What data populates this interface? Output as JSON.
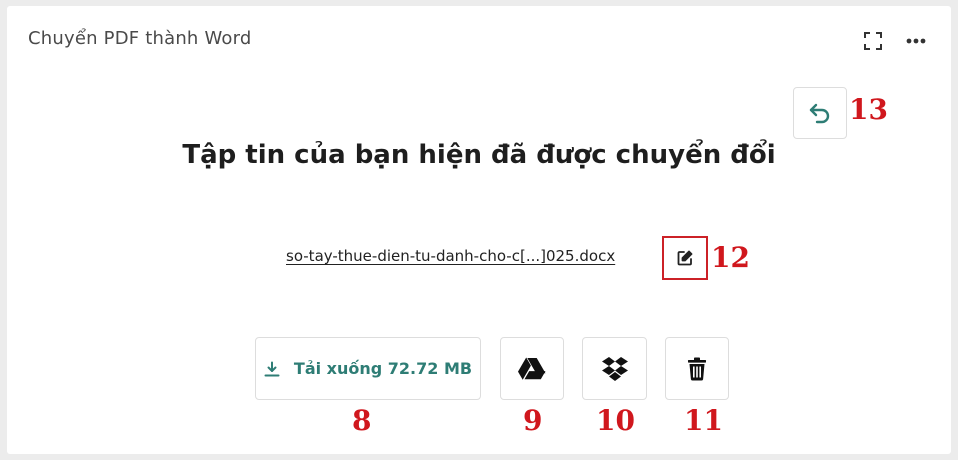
{
  "card": {
    "title": "Chuyển PDF thành Word"
  },
  "header_actions": {
    "expand_icon": "expand-icon",
    "more_icon": "more-horizontal-icon"
  },
  "result": {
    "heading": "Tập tin của bạn hiện đã được chuyển đổi",
    "filename": "so-tay-thue-dien-tu-danh-cho-c[...]025.docx"
  },
  "actions": {
    "download_label": "Tải xuống 72.72 MB",
    "download_icon": "download-icon",
    "gdrive_icon": "google-drive-icon",
    "dropbox_icon": "dropbox-icon",
    "delete_icon": "trash-icon",
    "rename_icon": "edit-icon",
    "undo_icon": "undo-icon"
  },
  "annotations": {
    "m8": "8",
    "m9": "9",
    "m10": "10",
    "m11": "11",
    "m12": "12",
    "m13": "13"
  },
  "colors": {
    "accent": "#2e7d75",
    "marker": "#d0171d",
    "highlight_border": "#cc2127"
  }
}
